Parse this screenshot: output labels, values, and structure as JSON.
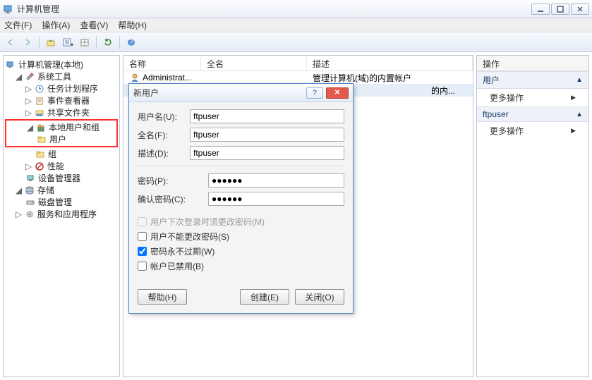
{
  "window": {
    "title": "计算机管理"
  },
  "menu": {
    "file": "文件(F)",
    "action": "操作(A)",
    "view": "查看(V)",
    "help": "帮助(H)"
  },
  "tree": {
    "root": "计算机管理(本地)",
    "systemTools": "系统工具",
    "taskScheduler": "任务计划程序",
    "eventViewer": "事件查看器",
    "sharedFolders": "共享文件夹",
    "localUsersGroups": "本地用户和组",
    "users": "用户",
    "groups": "组",
    "performance": "性能",
    "deviceManager": "设备管理器",
    "storage": "存储",
    "diskManagement": "磁盘管理",
    "servicesApps": "服务和应用程序"
  },
  "list": {
    "cols": {
      "name": "名称",
      "fullName": "全名",
      "description": "描述"
    },
    "rows": [
      {
        "name": "Administrat...",
        "fullName": "",
        "description": "管理计算机(域)的内置帐户"
      },
      {
        "name": "",
        "fullName": "",
        "description": "的内..."
      }
    ]
  },
  "actions": {
    "header": "操作",
    "section1": "用户",
    "item1": "更多操作",
    "section2": "ftpuser",
    "item2": "更多操作"
  },
  "dialog": {
    "title": "新用户",
    "labels": {
      "username": "用户名(U):",
      "fullname": "全名(F):",
      "description": "描述(D):",
      "password": "密码(P):",
      "confirm": "确认密码(C):"
    },
    "values": {
      "username": "ftpuser",
      "fullname": "ftpuser",
      "description": "ftpuser",
      "password": "●●●●●●",
      "confirm": "●●●●●●"
    },
    "checks": {
      "mustChange": "用户下次登录时须更改密码(M)",
      "cannotChange": "用户不能更改密码(S)",
      "neverExpires": "密码永不过期(W)",
      "disabled": "帐户已禁用(B)"
    },
    "checkState": {
      "mustChange": false,
      "cannotChange": false,
      "neverExpires": true,
      "disabled": false
    },
    "buttons": {
      "help": "帮助(H)",
      "create": "创建(E)",
      "close": "关闭(O)"
    }
  }
}
